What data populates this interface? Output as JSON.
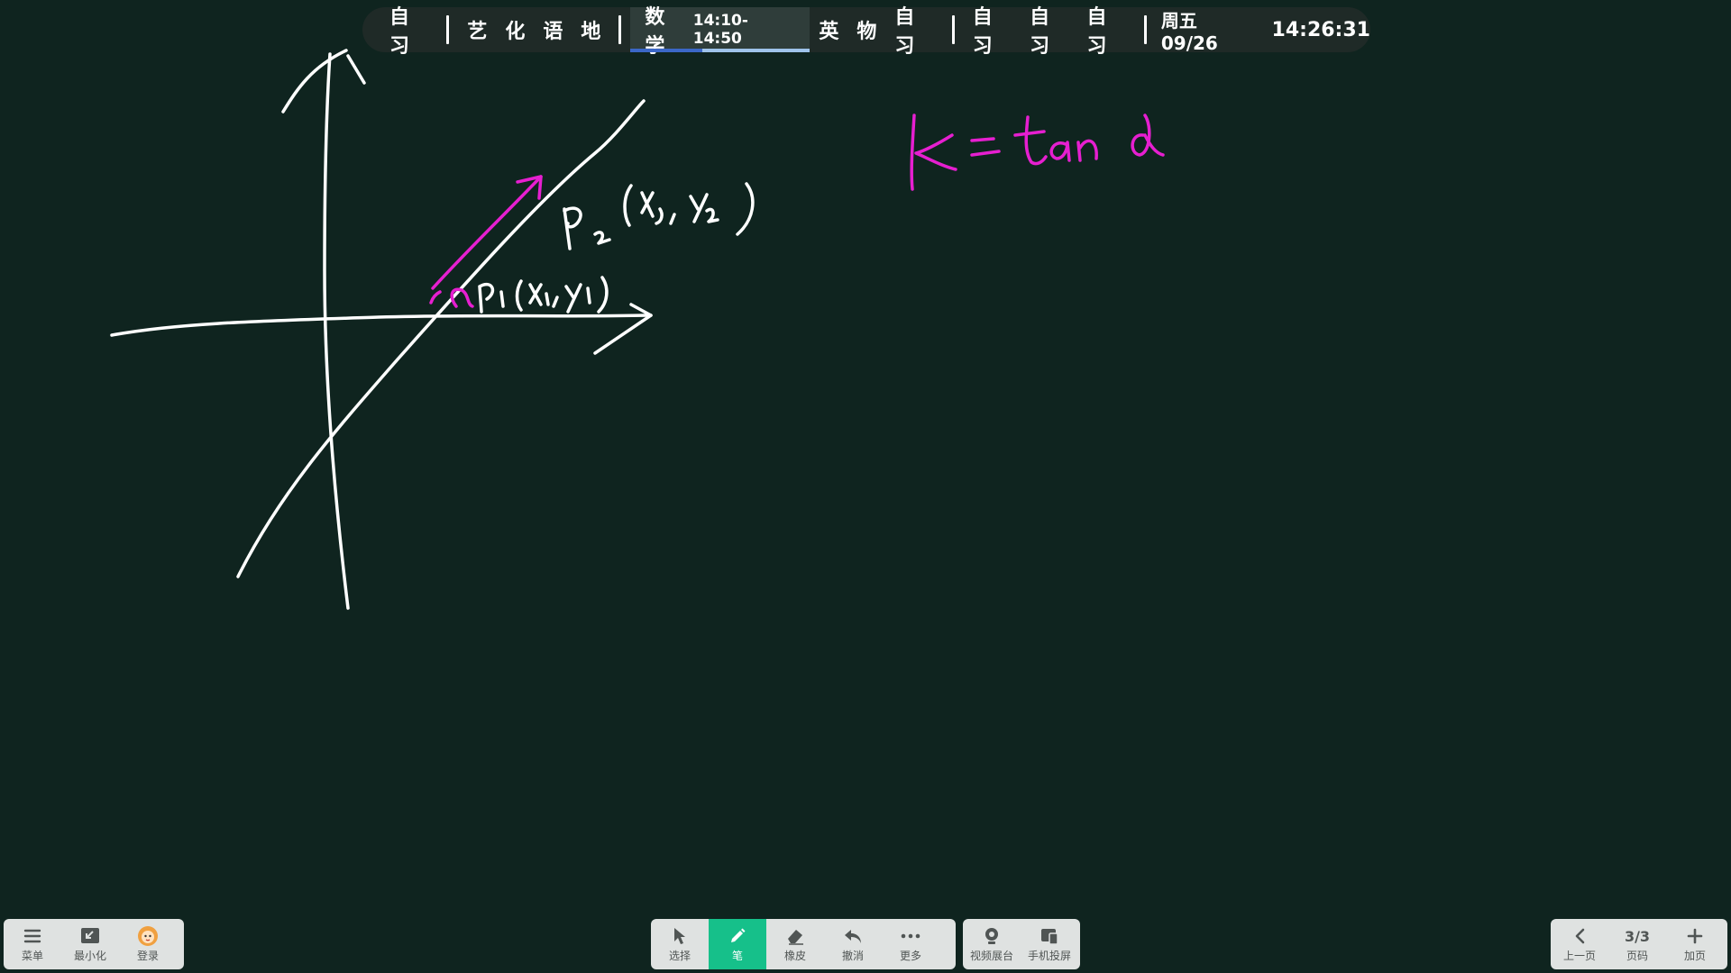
{
  "schedule": {
    "periods_a": [
      "自习"
    ],
    "periods_b": [
      "艺",
      "化",
      "语",
      "地"
    ],
    "current": {
      "subject": "数学",
      "time": "14:10-14:50",
      "progress": 0.4
    },
    "periods_c": [
      "英",
      "物",
      "自习"
    ],
    "periods_d": [
      "自习",
      "自习",
      "自习"
    ],
    "date": "周五 09/26",
    "clock": "14:26:31"
  },
  "board": {
    "formula_color": "#e61fd0",
    "ink_color": "#ffffff",
    "handwriting": [
      "P₂(x₂,y₂)",
      "P₁(x₁,y₁)",
      "k = tan α",
      "α"
    ]
  },
  "left_toolbar": {
    "menu": "菜单",
    "minimize": "最小化",
    "login": "登录"
  },
  "center_toolbar": {
    "select": "选择",
    "pen": "笔",
    "eraser": "橡皮",
    "undo": "撤消",
    "more": "更多"
  },
  "extra_toolbar": {
    "visualizer": "视频展台",
    "phone_cast": "手机投屏"
  },
  "right_toolbar": {
    "prev": "上一页",
    "page_number": "3/3",
    "page_label": "页码",
    "add": "加页"
  },
  "colors": {
    "accent": "#16c08a",
    "background": "#0f241f",
    "progress_done": "#3b67c7",
    "progress_rest": "#9fc3ea"
  }
}
